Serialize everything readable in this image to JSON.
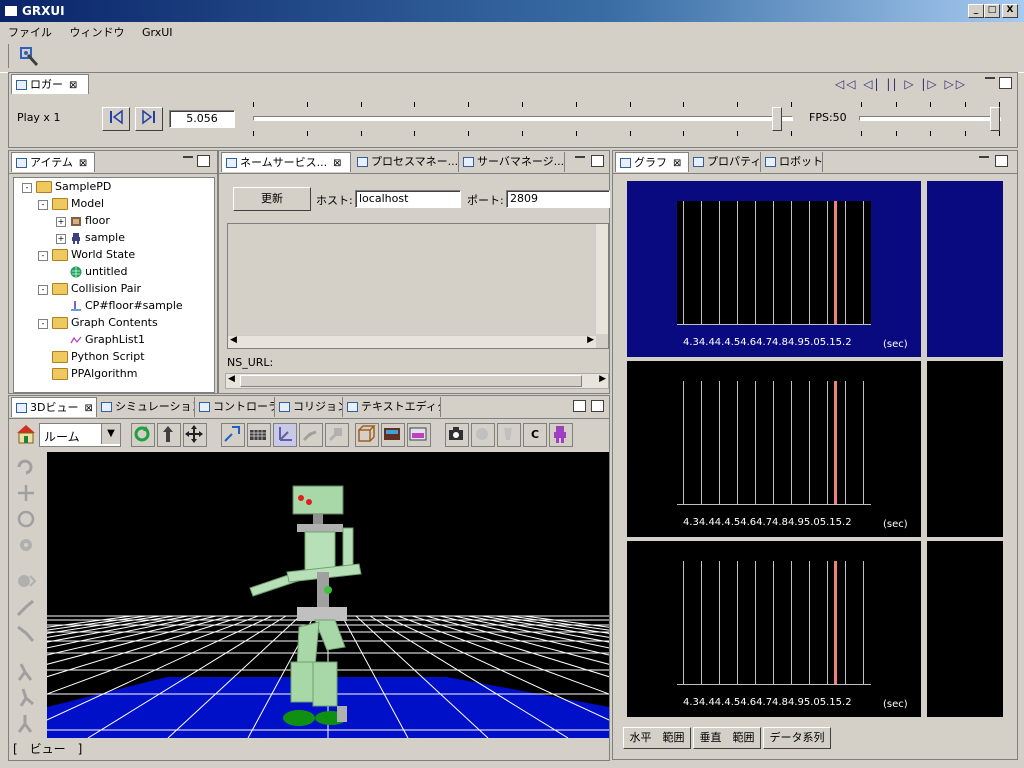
{
  "window": {
    "title": "GRXUI",
    "min": "_",
    "max": "□",
    "close": "X"
  },
  "menu": [
    "ファイル",
    "ウィンドウ",
    "GrxUI"
  ],
  "logger": {
    "tab": "ロガー",
    "play_label": "Play x 1",
    "time_value": "5.056",
    "fps_label": "FPS:50",
    "progress": 0.98,
    "fps_slider": 0.98
  },
  "items_panel": {
    "tab": "アイテム",
    "tree": [
      {
        "label": "SamplePD",
        "depth": 0,
        "icon": "folder",
        "exp": "-"
      },
      {
        "label": "Model",
        "depth": 1,
        "icon": "folder",
        "exp": "-"
      },
      {
        "label": "floor",
        "depth": 2,
        "icon": "floor",
        "exp": "+"
      },
      {
        "label": "sample",
        "depth": 2,
        "icon": "robot",
        "exp": "+"
      },
      {
        "label": "World State",
        "depth": 1,
        "icon": "folder",
        "exp": "-"
      },
      {
        "label": "untitled",
        "depth": 2,
        "icon": "world",
        "exp": ""
      },
      {
        "label": "Collision Pair",
        "depth": 1,
        "icon": "folder",
        "exp": "-"
      },
      {
        "label": "CP#floor#sample",
        "depth": 2,
        "icon": "collision",
        "exp": ""
      },
      {
        "label": "Graph Contents",
        "depth": 1,
        "icon": "folder",
        "exp": "-"
      },
      {
        "label": "GraphList1",
        "depth": 2,
        "icon": "graph",
        "exp": ""
      },
      {
        "label": "Python Script",
        "depth": 1,
        "icon": "folder",
        "exp": ""
      },
      {
        "label": "PPAlgorithm",
        "depth": 1,
        "icon": "folder",
        "exp": ""
      }
    ]
  },
  "ns_panel": {
    "tabs": [
      "ネームサービス...",
      "プロセスマネー...",
      "サーバマネージ..."
    ],
    "refresh": "更新",
    "host_label": "ホスト:",
    "host_value": "localhost",
    "port_label": "ポート:",
    "port_value": "2809",
    "ns_url_label": "NS_URL:"
  },
  "view3d": {
    "tabs": [
      "3Dビュー",
      "シミュレーション",
      "コントローラ",
      "コリジョン",
      "テキストエディタ"
    ],
    "viewpoint": "ルーム",
    "status": "[　ビュー　]",
    "c_button": "C"
  },
  "graph_panel": {
    "tabs": [
      "グラフ",
      "プロパティ",
      "ロボット"
    ],
    "ticks": [
      "4.3",
      "4.4",
      "4.4",
      "4.5",
      "4.6",
      "4.7",
      "4.8",
      "4.9",
      "5.0",
      "5.1",
      "5.2"
    ],
    "tick_text": "4.34.44.4.54.64.74.84.95.05.15.2",
    "unit": "(sec)",
    "buttons": [
      "水平　範囲",
      "垂直　範囲",
      "データ系列"
    ]
  }
}
